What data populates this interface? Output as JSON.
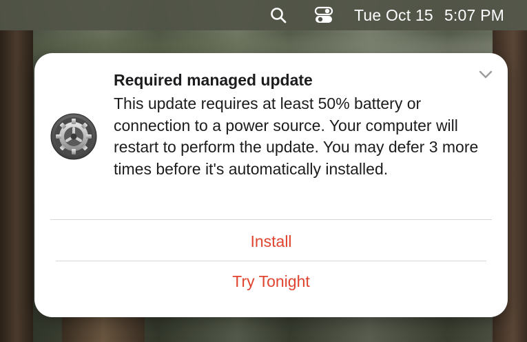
{
  "menubar": {
    "icons": [
      "search-icon",
      "control-center-icon"
    ],
    "date": "Tue Oct 15",
    "time": "5:07 PM"
  },
  "notification": {
    "app_icon": "system-preferences-gear-icon",
    "title": "Required managed update",
    "body": "This update requires at least 50% battery or connection to a power source. Your computer will restart to perform the update. You may defer 3 more times before it's automatically installed.",
    "actions": [
      {
        "label": "Install"
      },
      {
        "label": "Try Tonight"
      }
    ],
    "accent_color": "#e0442f",
    "expand_icon": "chevron-down-icon"
  }
}
